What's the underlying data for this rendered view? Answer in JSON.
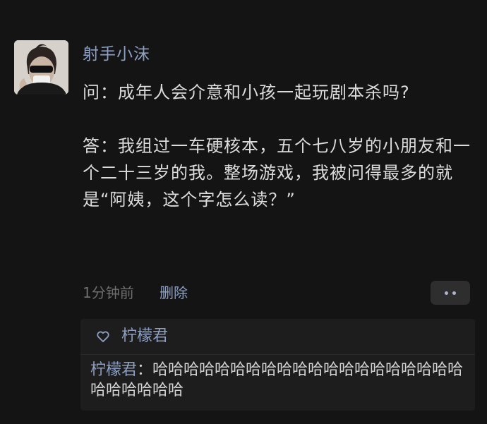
{
  "post": {
    "username": "射手小沫",
    "question": "问：成年人会介意和小孩一起玩剧本杀吗?",
    "answer": "答：我组过一车硬核本，五个七八岁的小朋友和一个二十三岁的我。整场游戏，我被问得最多的就是“阿姨，这个字怎么读？”",
    "time": "1分钟前",
    "delete_label": "删除"
  },
  "icons": {
    "avatar": "avatar-photo",
    "more": "more-dots-icon",
    "like": "heart-outline-icon"
  },
  "likes": {
    "names": "柠檬君"
  },
  "comments": [
    {
      "author": "柠檬君",
      "separator": "：",
      "text": "哈哈哈哈哈哈哈哈哈哈哈哈哈哈哈哈哈哈哈哈哈哈哈哈哈哈"
    }
  ],
  "colors": {
    "background": "#141414",
    "link": "#8d9fc2",
    "text": "#dcdcdc",
    "muted": "#6e6e6e",
    "panel": "#1d1d1d"
  }
}
